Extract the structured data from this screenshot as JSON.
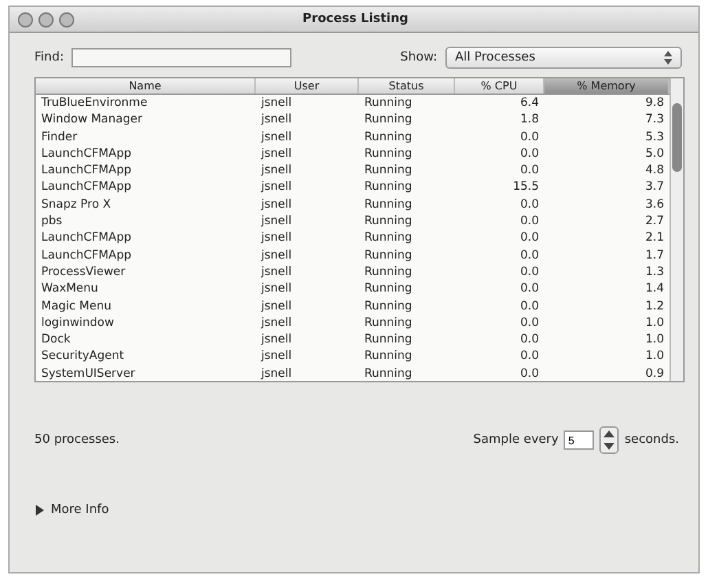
{
  "window": {
    "title": "Process Listing"
  },
  "find": {
    "label": "Find:"
  },
  "show": {
    "label": "Show:",
    "value": "All Processes"
  },
  "table": {
    "columns": [
      {
        "label": "Name",
        "selected": false
      },
      {
        "label": "User",
        "selected": false
      },
      {
        "label": "Status",
        "selected": false
      },
      {
        "label": "% CPU",
        "selected": false
      },
      {
        "label": "% Memory",
        "selected": true
      }
    ],
    "rows": [
      [
        "TruBlueEnvironme",
        "jsnell",
        "Running",
        "6.4",
        "9.8"
      ],
      [
        "Window Manager",
        "jsnell",
        "Running",
        "1.8",
        "7.3"
      ],
      [
        "Finder",
        "jsnell",
        "Running",
        "0.0",
        "5.3"
      ],
      [
        "LaunchCFMApp",
        "jsnell",
        "Running",
        "0.0",
        "5.0"
      ],
      [
        "LaunchCFMApp",
        "jsnell",
        "Running",
        "0.0",
        "4.8"
      ],
      [
        "LaunchCFMApp",
        "jsnell",
        "Running",
        "15.5",
        "3.7"
      ],
      [
        "Snapz Pro X",
        "jsnell",
        "Running",
        "0.0",
        "3.6"
      ],
      [
        "pbs",
        "jsnell",
        "Running",
        "0.0",
        "2.7"
      ],
      [
        "LaunchCFMApp",
        "jsnell",
        "Running",
        "0.0",
        "2.1"
      ],
      [
        "LaunchCFMApp",
        "jsnell",
        "Running",
        "0.0",
        "1.7"
      ],
      [
        "ProcessViewer",
        "jsnell",
        "Running",
        "0.0",
        "1.3"
      ],
      [
        "WaxMenu",
        "jsnell",
        "Running",
        "0.0",
        "1.4"
      ],
      [
        "Magic Menu",
        "jsnell",
        "Running",
        "0.0",
        "1.2"
      ],
      [
        "loginwindow",
        "jsnell",
        "Running",
        "0.0",
        "1.0"
      ],
      [
        "Dock",
        "jsnell",
        "Running",
        "0.0",
        "1.0"
      ],
      [
        "SecurityAgent",
        "jsnell",
        "Running",
        "0.0",
        "1.0"
      ],
      [
        "SystemUIServer",
        "jsnell",
        "Running",
        "0.0",
        "0.9"
      ]
    ]
  },
  "process_count": "50 processes.",
  "sample": {
    "label": "Sample every",
    "value": "5",
    "unit": "seconds."
  },
  "more_info": {
    "label": "More Info",
    "expanded": false
  }
}
